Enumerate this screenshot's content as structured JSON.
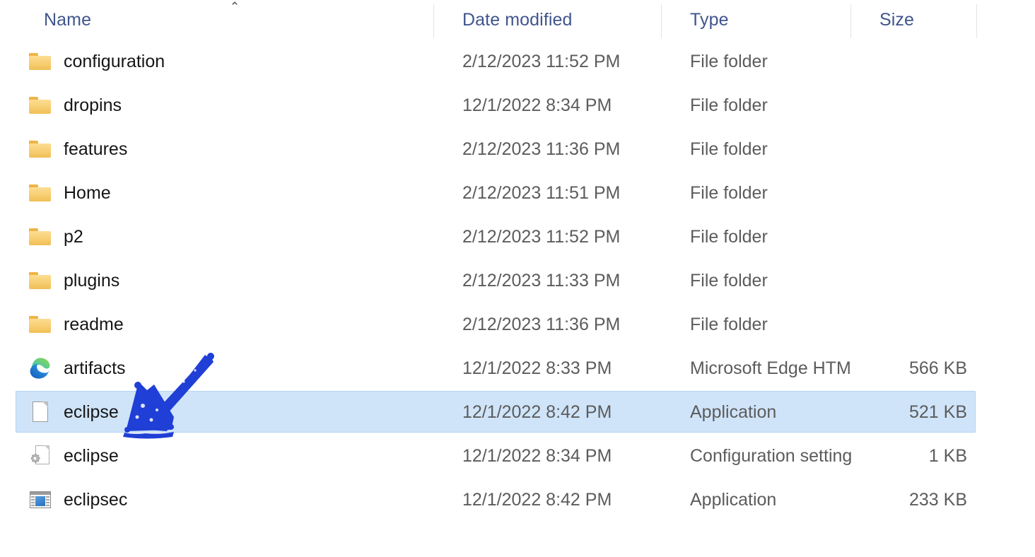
{
  "header": {
    "sort_indicator": "⌃",
    "columns": [
      {
        "label": "Name",
        "name": "column-header-name"
      },
      {
        "label": "Date modified",
        "name": "column-header-date-modified"
      },
      {
        "label": "Type",
        "name": "column-header-type"
      },
      {
        "label": "Size",
        "name": "column-header-size"
      }
    ]
  },
  "colors": {
    "header_text": "#41558d",
    "name_text": "#161616",
    "meta_text": "#5c5c5c",
    "selection_fill": "#cfe4f9",
    "selection_border": "#b4d4f2",
    "folder_icon": "#f7ce72",
    "annotation_arrow": "#1f3fd6"
  },
  "rows": [
    {
      "icon": "folder-icon",
      "name": "configuration",
      "date": "2/12/2023 11:52 PM",
      "type": "File folder",
      "size": "",
      "selected": false
    },
    {
      "icon": "folder-icon",
      "name": "dropins",
      "date": "12/1/2022 8:34 PM",
      "type": "File folder",
      "size": "",
      "selected": false
    },
    {
      "icon": "folder-icon",
      "name": "features",
      "date": "2/12/2023 11:36 PM",
      "type": "File folder",
      "size": "",
      "selected": false
    },
    {
      "icon": "folder-icon",
      "name": "Home",
      "date": "2/12/2023 11:51 PM",
      "type": "File folder",
      "size": "",
      "selected": false
    },
    {
      "icon": "folder-icon",
      "name": "p2",
      "date": "2/12/2023 11:52 PM",
      "type": "File folder",
      "size": "",
      "selected": false
    },
    {
      "icon": "folder-icon",
      "name": "plugins",
      "date": "2/12/2023 11:33 PM",
      "type": "File folder",
      "size": "",
      "selected": false
    },
    {
      "icon": "folder-icon",
      "name": "readme",
      "date": "2/12/2023 11:36 PM",
      "type": "File folder",
      "size": "",
      "selected": false
    },
    {
      "icon": "edge-browser-icon",
      "name": "artifacts",
      "date": "12/1/2022 8:33 PM",
      "type": "Microsoft Edge HTM...",
      "size": "566 KB",
      "selected": false
    },
    {
      "icon": "blank-document-icon",
      "name": "eclipse",
      "date": "12/1/2022 8:42 PM",
      "type": "Application",
      "size": "521 KB",
      "selected": true
    },
    {
      "icon": "document-gear-icon",
      "name": "eclipse",
      "date": "12/1/2022 8:34 PM",
      "type": "Configuration settings",
      "size": "1 KB",
      "selected": false
    },
    {
      "icon": "application-icon",
      "name": "eclipsec",
      "date": "12/1/2022 8:42 PM",
      "type": "Application",
      "size": "233 KB",
      "selected": false
    }
  ],
  "annotation": {
    "shape": "hand-drawn-arrow",
    "points_to": "eclipse"
  }
}
